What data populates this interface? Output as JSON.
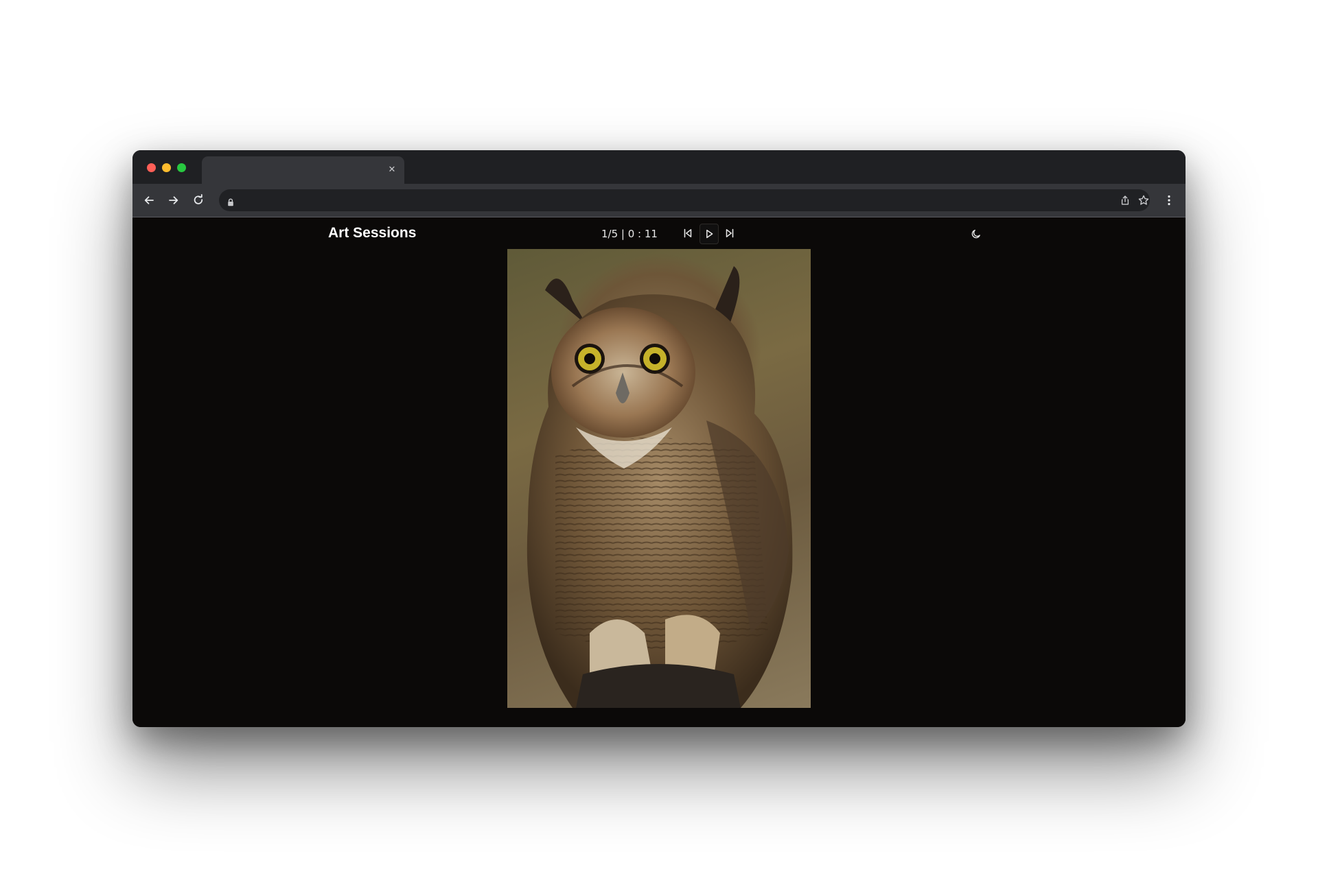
{
  "browser": {
    "tab_title": "",
    "tab_close_icon": "close-icon",
    "url": "",
    "icons": {
      "back": "arrow-left-icon",
      "forward": "arrow-right-icon",
      "reload": "reload-icon",
      "lock": "lock-icon",
      "share": "share-icon",
      "bookmark": "star-icon",
      "menu": "kebab-menu-icon"
    },
    "traffic_lights": {
      "close": "#ff5f57",
      "minimize": "#febc2e",
      "zoom": "#28c840"
    }
  },
  "app": {
    "title": "Art Sessions",
    "counter": "1/5 | 0 : 11",
    "controls": {
      "previous_icon": "skip-previous-icon",
      "play_icon": "play-icon",
      "next_icon": "skip-next-icon"
    },
    "theme_icon": "moon-icon",
    "artwork_subject": "great horned owl perched on a gloved hand",
    "colors": {
      "background": "#0b0908",
      "text": "#ffffff"
    }
  }
}
